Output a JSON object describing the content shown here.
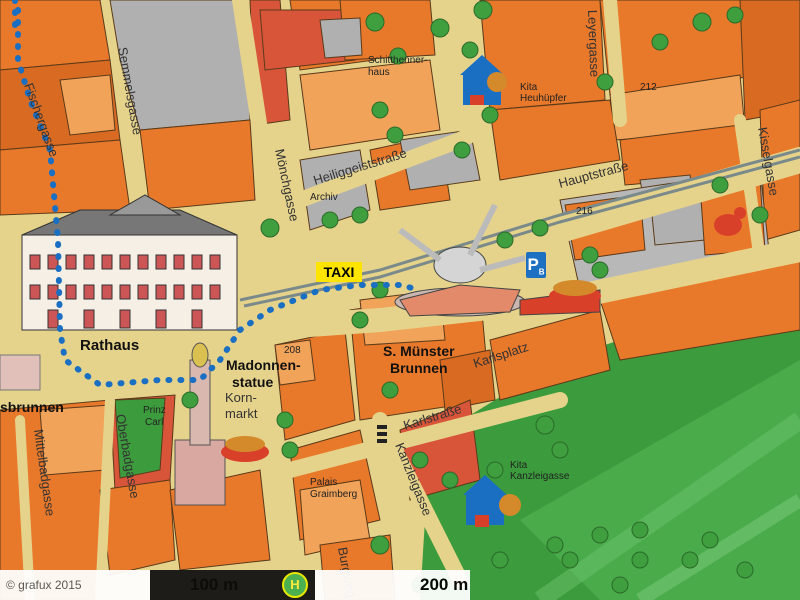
{
  "map": {
    "buildings_labels": {
      "rathaus": "Rathaus",
      "madonnenstatue_1": "Madonnen-",
      "madonnenstatue_2": "statue",
      "brunnen_1": "S. Münster",
      "brunnen_2": "Brunnen",
      "brunnen_left": "sbrunnen",
      "schitthenner_1": "Schitthenner-",
      "schitthenner_2": "haus",
      "archiv": "Archiv",
      "prinz_carl_1": "Prinz",
      "prinz_carl_2": "Carl",
      "palais_1": "Palais",
      "palais_2": "Graimberg",
      "kita1_1": "Kita",
      "kita1_2": "Heuhüpfer",
      "kita2_1": "Kita",
      "kita2_2": "Kanzleigasse",
      "kornmarkt_1": "Korn-",
      "kornmarkt_2": "markt"
    },
    "numbers": {
      "n212": "212",
      "n216": "216",
      "n208": "208"
    },
    "streets": {
      "fischergasse": "Fischergasse",
      "semmelsgasse": "Semmelsgasse",
      "moenchgasse": "Mönchgasse",
      "heiliggeiststrasse": "Heiliggeiststraße",
      "leyergasse": "Leyergasse",
      "hauptstrasse": "Hauptstraße",
      "kisselgasse": "Kisselgasse",
      "karlsplatz": "Karlsplatz",
      "karlstrasse": "Karlstraße",
      "kanzleigasse": "Kanzleigasse",
      "oberbadgasse": "Oberbadgasse",
      "mittelbadgasse": "Mittelbadgasse",
      "burgweg": "Burgweg"
    },
    "taxi": "TAXI",
    "parking": "P",
    "parking_sub": "B",
    "bus_stop": "H",
    "scale": {
      "copyright": "© grafux 2015",
      "m100": "100 m",
      "m200": "200 m"
    },
    "colors": {
      "street": "#e8d58a",
      "building_orange": "#e8782a",
      "building_light": "#f2a35a",
      "building_grey": "#a8a8a8",
      "building_red": "#d9553a",
      "green": "#3fa63f",
      "route": "#1a6fc2"
    }
  }
}
